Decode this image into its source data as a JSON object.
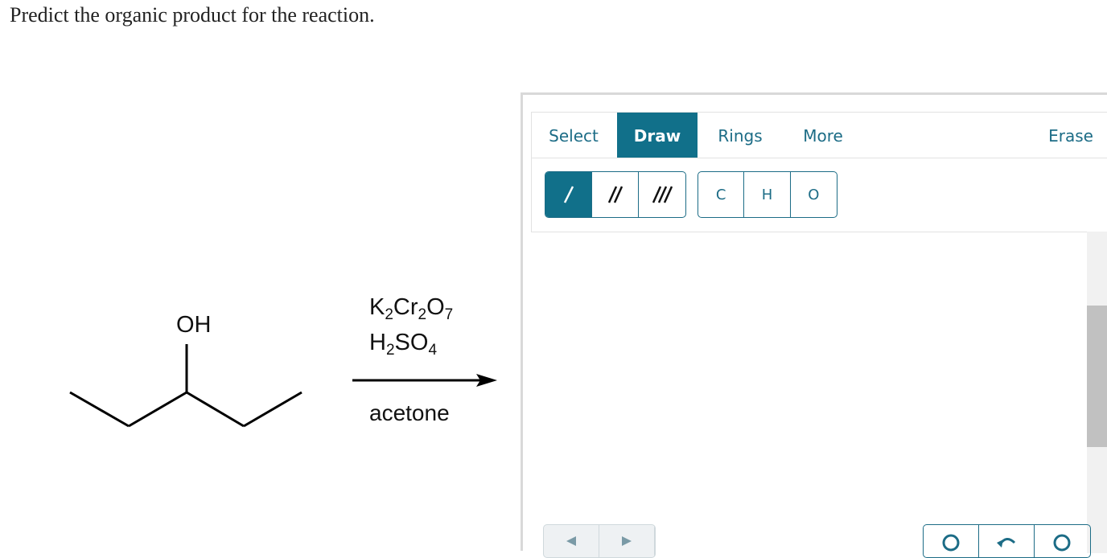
{
  "question": {
    "text": "Predict the organic product for the reaction."
  },
  "reaction": {
    "reactant_label": "OH",
    "reagent1": {
      "a": "K",
      "a_sub": "2",
      "b": "Cr",
      "b_sub": "2",
      "c": "O",
      "c_sub": "7"
    },
    "reagent2": {
      "a": "H",
      "a_sub": "2",
      "b": "SO",
      "b_sub": "4"
    },
    "solvent": "acetone"
  },
  "editor": {
    "tabs": {
      "select": "Select",
      "draw": "Draw",
      "rings": "Rings",
      "more": "More",
      "erase": "Erase"
    },
    "atoms": {
      "c": "C",
      "h": "H",
      "o": "O"
    },
    "colors": {
      "accent": "#11708a",
      "accent_text": "#1c6c86",
      "border": "#d9d9d9"
    },
    "bond_tools": [
      "single-bond-icon",
      "double-bond-icon",
      "triple-bond-icon"
    ]
  }
}
